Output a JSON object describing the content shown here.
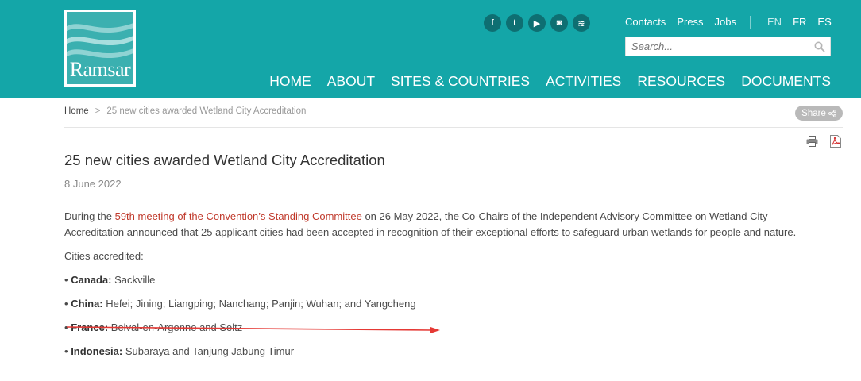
{
  "logo": {
    "text": "Ramsar"
  },
  "social": [
    {
      "icon": "facebook-icon",
      "glyph": "f"
    },
    {
      "icon": "twitter-icon",
      "glyph": "t"
    },
    {
      "icon": "youtube-icon",
      "glyph": "▶"
    },
    {
      "icon": "instagram-icon",
      "glyph": "◙"
    },
    {
      "icon": "rss-icon",
      "glyph": "≋"
    }
  ],
  "toplinks": {
    "contacts": "Contacts",
    "press": "Press",
    "jobs": "Jobs"
  },
  "langs": {
    "en": "EN",
    "fr": "FR",
    "es": "ES"
  },
  "search": {
    "placeholder": "Search..."
  },
  "nav": {
    "home": "HOME",
    "about": "ABOUT",
    "sites": "SITES & COUNTRIES",
    "activities": "ACTIVITIES",
    "resources": "RESOURCES",
    "documents": "DOCUMENTS"
  },
  "breadcrumb": {
    "home": "Home",
    "sep": ">",
    "current": "25 new cities awarded Wetland City Accreditation"
  },
  "share": {
    "label": "Share"
  },
  "article": {
    "title": "25 new cities awarded Wetland City Accreditation",
    "date": "8 June 2022",
    "p1_before": "During the ",
    "p1_link": "59th meeting of the Convention’s Standing Committee",
    "p1_after": " on 26 May 2022, the Co-Chairs of the Independent Advisory Committee on Wetland City Accreditation announced that 25 applicant cities had been accepted in recognition of their exceptional efforts to safeguard urban wetlands for people and nature.",
    "cities_intro": "Cities accredited:",
    "bullet": "•",
    "countries": [
      {
        "name": "Canada:",
        "cities": "Sackville"
      },
      {
        "name": "China:",
        "cities": "Hefei; Jining; Liangping; Nanchang; Panjin; Wuhan; and Yangcheng"
      },
      {
        "name": "France:",
        "cities": "Belval-en-Argonne and Seltz"
      },
      {
        "name": "Indonesia:",
        "cities": "Subaraya and Tanjung Jabung Timur"
      }
    ]
  },
  "colors": {
    "header": "#14a6a8",
    "link": "#c0392b",
    "annotation": "#e53935"
  }
}
